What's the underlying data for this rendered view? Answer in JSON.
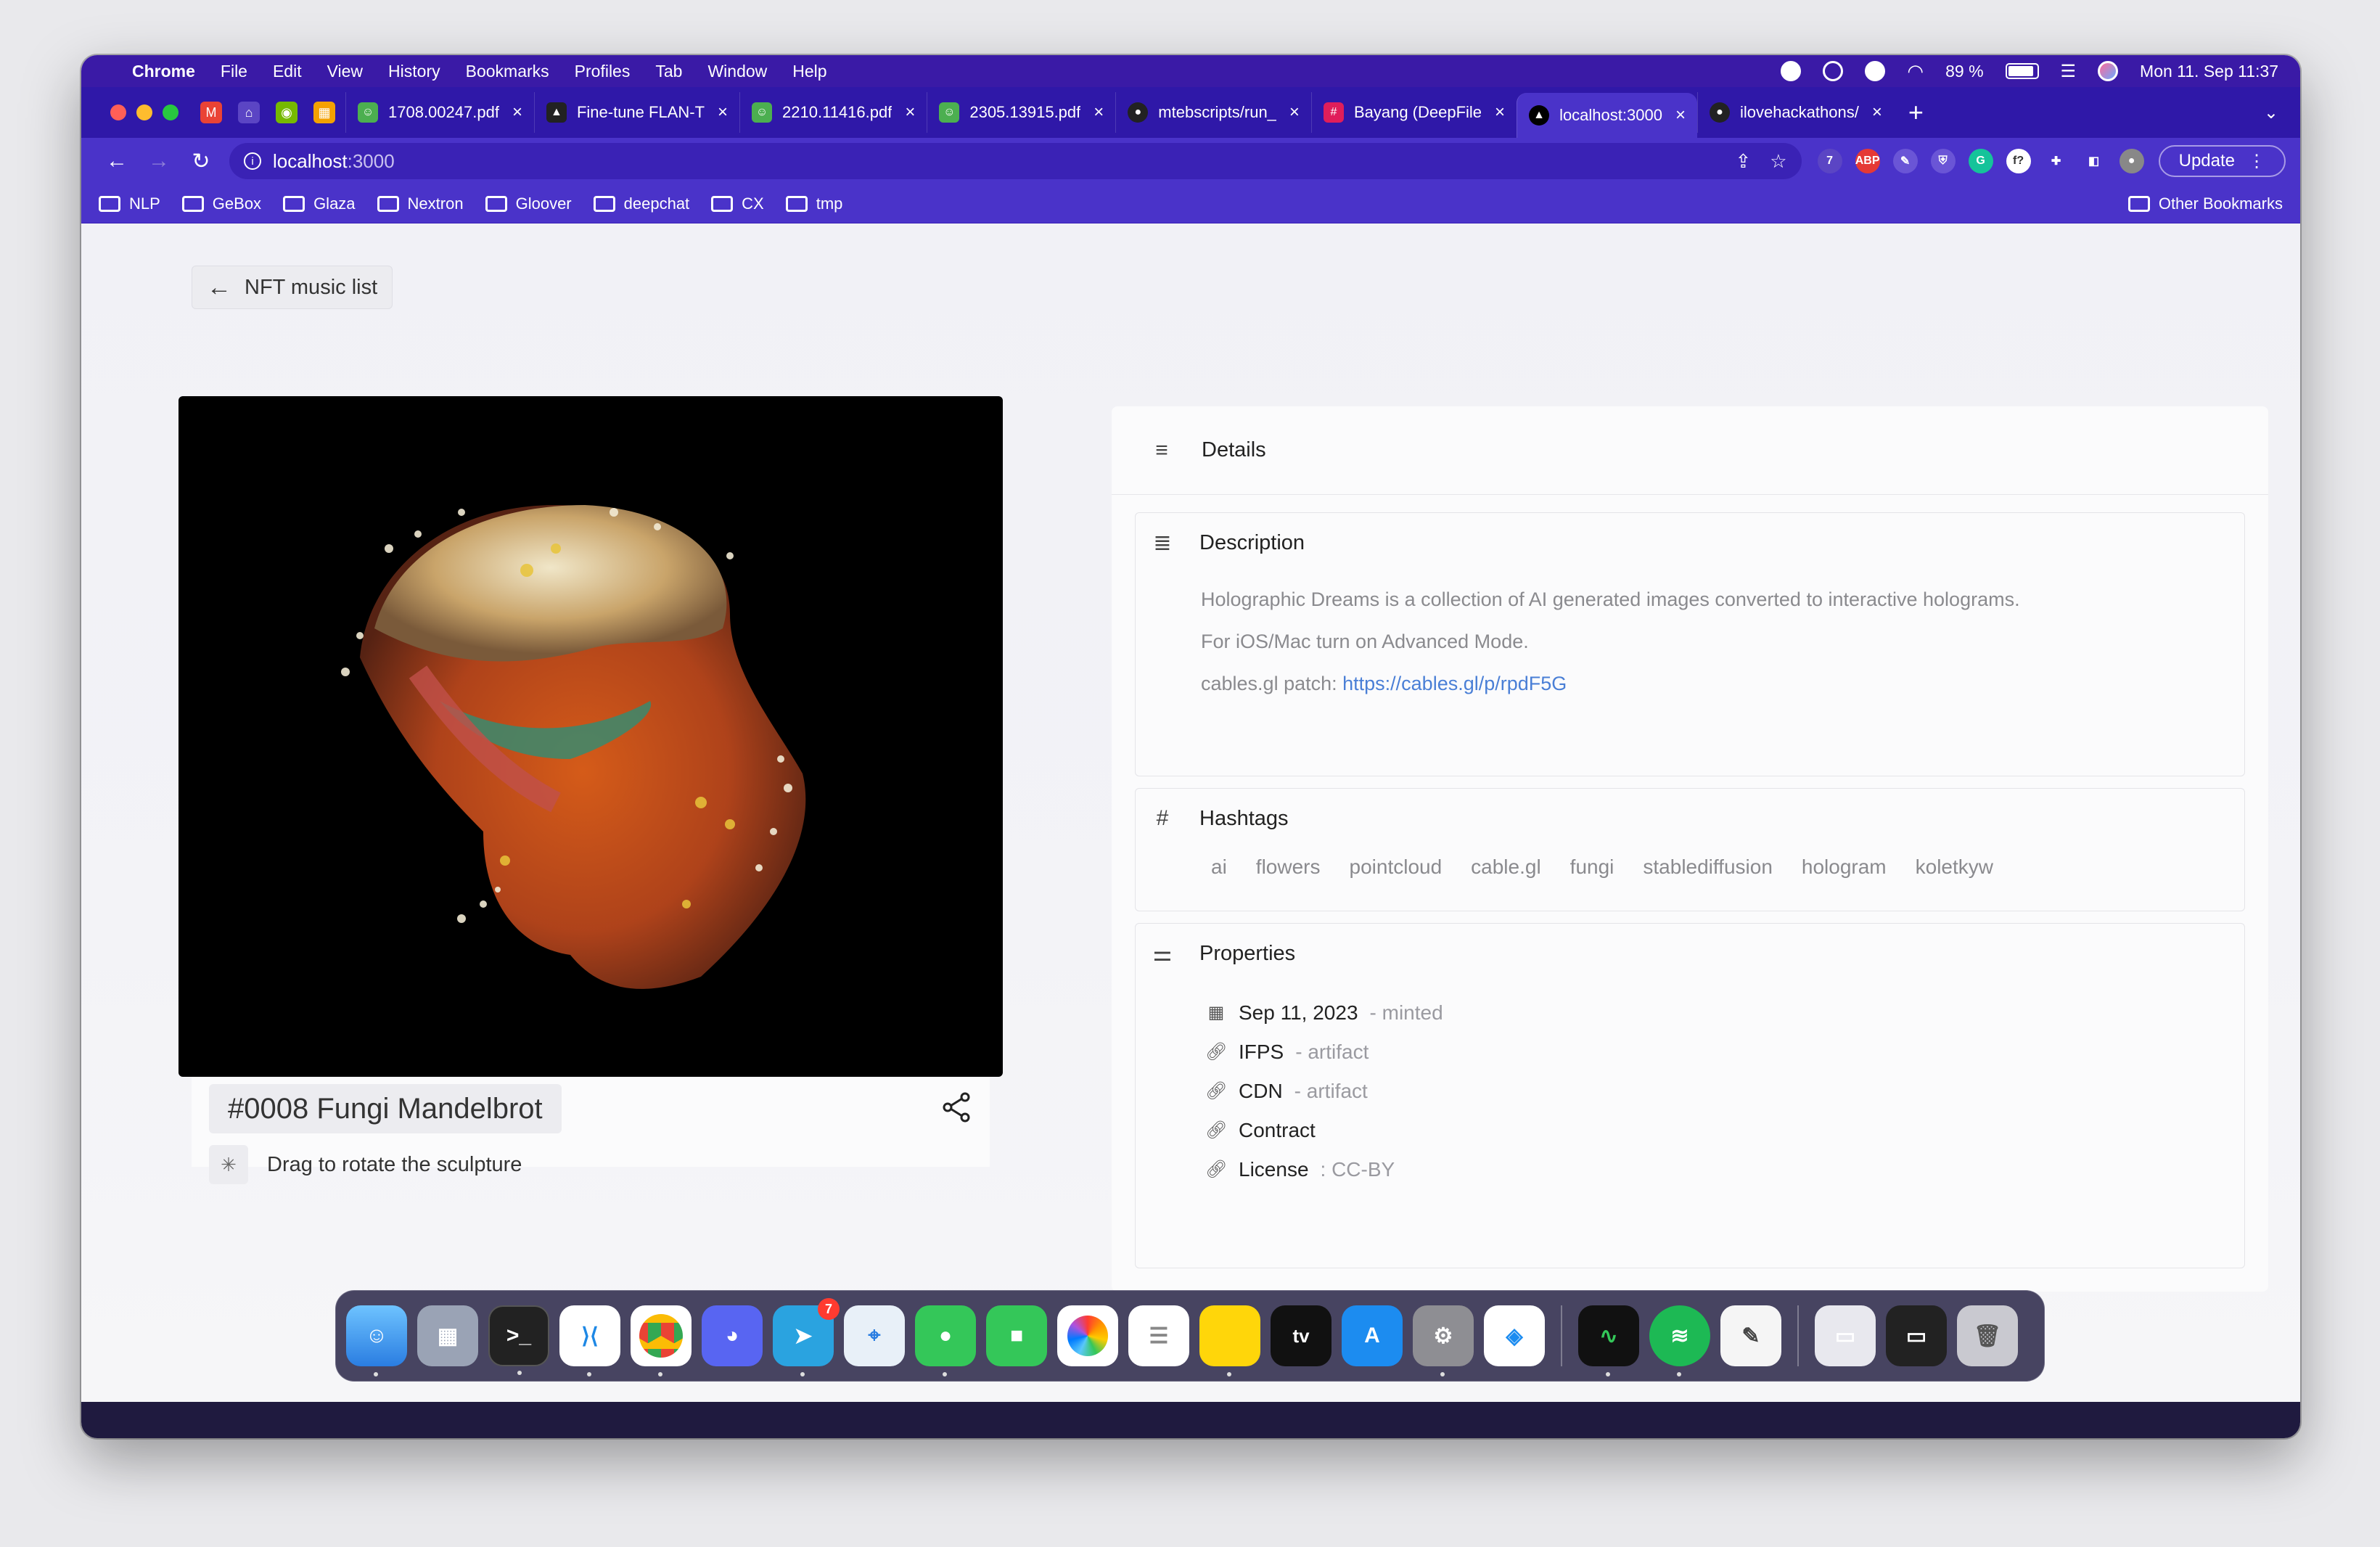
{
  "menubar": {
    "items": [
      "Chrome",
      "File",
      "Edit",
      "View",
      "History",
      "Bookmarks",
      "Profiles",
      "Tab",
      "Window",
      "Help"
    ],
    "battery": "89 %",
    "clock": "Mon 11. Sep  11:37"
  },
  "tabs": [
    {
      "title": "1708.00247.pdf",
      "color": "#4caf50"
    },
    {
      "title": "Fine-tune FLAN-T",
      "color": "#222222"
    },
    {
      "title": "2210.11416.pdf",
      "color": "#4caf50"
    },
    {
      "title": "2305.13915.pdf",
      "color": "#4caf50"
    },
    {
      "title": "mtebscripts/run_",
      "color": "#222222"
    },
    {
      "title": "Bayang (DeepFile",
      "color": "#e01e5a"
    },
    {
      "title": "localhost:3000",
      "color": "#000000",
      "active": true
    },
    {
      "title": "ilovehackathons/",
      "color": "#222222"
    }
  ],
  "omnibox": {
    "host": "localhost",
    "port": ":3000"
  },
  "toolbar": {
    "update_label": "Update"
  },
  "bookmarks": [
    "NLP",
    "GeBox",
    "Glaza",
    "Nextron",
    "Gloover",
    "deepchat",
    "CX",
    "tmp"
  ],
  "bookmarks_other": "Other Bookmarks",
  "page": {
    "back_label": "NFT music list",
    "title": "#0008 Fungi Mandelbrot",
    "hint": "Drag to rotate the sculpture",
    "details_label": "Details",
    "description": {
      "label": "Description",
      "line1": "Holographic Dreams is a collection of AI generated images converted to interactive holograms.",
      "line2": "For iOS/Mac turn on Advanced Mode.",
      "line3_prefix": "cables.gl patch: ",
      "link": "https://cables.gl/p/rpdF5G"
    },
    "hashtags": {
      "label": "Hashtags",
      "items": [
        "ai",
        "flowers",
        "pointcloud",
        "cable.gl",
        "fungi",
        "stablediffusion",
        "hologram",
        "koletkyw"
      ]
    },
    "properties": {
      "label": "Properties",
      "rows": [
        {
          "key": "Sep 11, 2023",
          "value": "- minted",
          "icon": "calendar-icon"
        },
        {
          "key": "IFPS",
          "value": "- artifact",
          "icon": "link-icon"
        },
        {
          "key": "CDN",
          "value": "- artifact",
          "icon": "link-icon"
        },
        {
          "key": "Contract",
          "value": "",
          "icon": "link-icon"
        },
        {
          "key": "License",
          "value": ": CC-BY",
          "icon": "link-icon"
        }
      ]
    }
  },
  "dock": {
    "telegram_badge": "7"
  },
  "colors": {
    "accent": "#4a33c9",
    "link": "#4a7fd6"
  }
}
